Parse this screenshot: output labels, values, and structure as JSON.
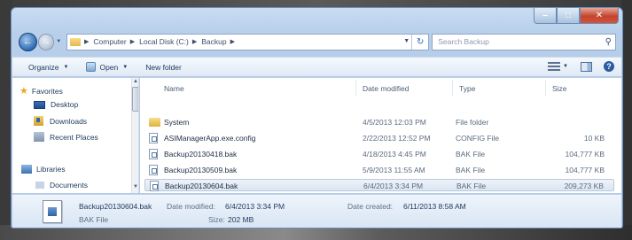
{
  "breadcrumb": [
    "Computer",
    "Local Disk (C:)",
    "Backup"
  ],
  "search": {
    "placeholder": "Search Backup"
  },
  "toolbar": {
    "organize": "Organize",
    "open": "Open",
    "new_folder": "New folder"
  },
  "nav": {
    "favorites": "Favorites",
    "desktop": "Desktop",
    "downloads": "Downloads",
    "recent_places": "Recent Places",
    "libraries": "Libraries",
    "documents": "Documents"
  },
  "columns": {
    "name": "Name",
    "date_modified": "Date modified",
    "type": "Type",
    "size": "Size"
  },
  "files": [
    {
      "name": "System",
      "date": "4/5/2013 12:03 PM",
      "type": "File folder",
      "size": ""
    },
    {
      "name": "ASIManagerApp.exe.config",
      "date": "2/22/2013 12:52 PM",
      "type": "CONFIG File",
      "size": "10 KB"
    },
    {
      "name": "Backup20130418.bak",
      "date": "4/18/2013 4:45 PM",
      "type": "BAK File",
      "size": "104,777 KB"
    },
    {
      "name": "Backup20130509.bak",
      "date": "5/9/2013 11:55 AM",
      "type": "BAK File",
      "size": "104,777 KB"
    },
    {
      "name": "Backup20130604.bak",
      "date": "6/4/2013 3:34 PM",
      "type": "BAK File",
      "size": "209,273 KB"
    }
  ],
  "details": {
    "file_name": "Backup20130604.bak",
    "file_type": "BAK File",
    "date_modified_label": "Date modified:",
    "date_modified": "6/4/2013 3:34 PM",
    "size_label": "Size:",
    "size": "202 MB",
    "date_created_label": "Date created:",
    "date_created": "6/11/2013 8:58 AM"
  }
}
